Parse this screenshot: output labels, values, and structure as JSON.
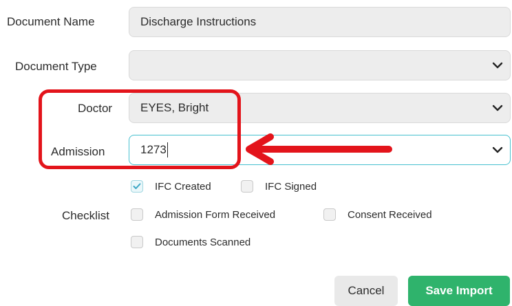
{
  "form": {
    "document_name": {
      "label": "Document Name",
      "value": "Discharge Instructions"
    },
    "document_type": {
      "label": "Document Type",
      "value": ""
    },
    "doctor": {
      "label": "Doctor",
      "value": "EYES, Bright"
    },
    "admission": {
      "label": "Admission",
      "value": "1273"
    },
    "checklist": {
      "label": "Checklist",
      "items": [
        {
          "label": "IFC Created",
          "checked": true
        },
        {
          "label": "IFC Signed",
          "checked": false
        },
        {
          "label": "Admission Form Received",
          "checked": false
        },
        {
          "label": "Consent Received",
          "checked": false
        },
        {
          "label": "Documents Scanned",
          "checked": false
        }
      ]
    }
  },
  "buttons": {
    "cancel": "Cancel",
    "save": "Save Import"
  },
  "colors": {
    "accent_green": "#2fb36c",
    "focus_teal": "#45c0cf",
    "annotation_red": "#e3141b"
  },
  "icons": {
    "dropdown": "chevron-down-icon",
    "check": "check-icon",
    "annotation": "red-arrow-icon"
  }
}
